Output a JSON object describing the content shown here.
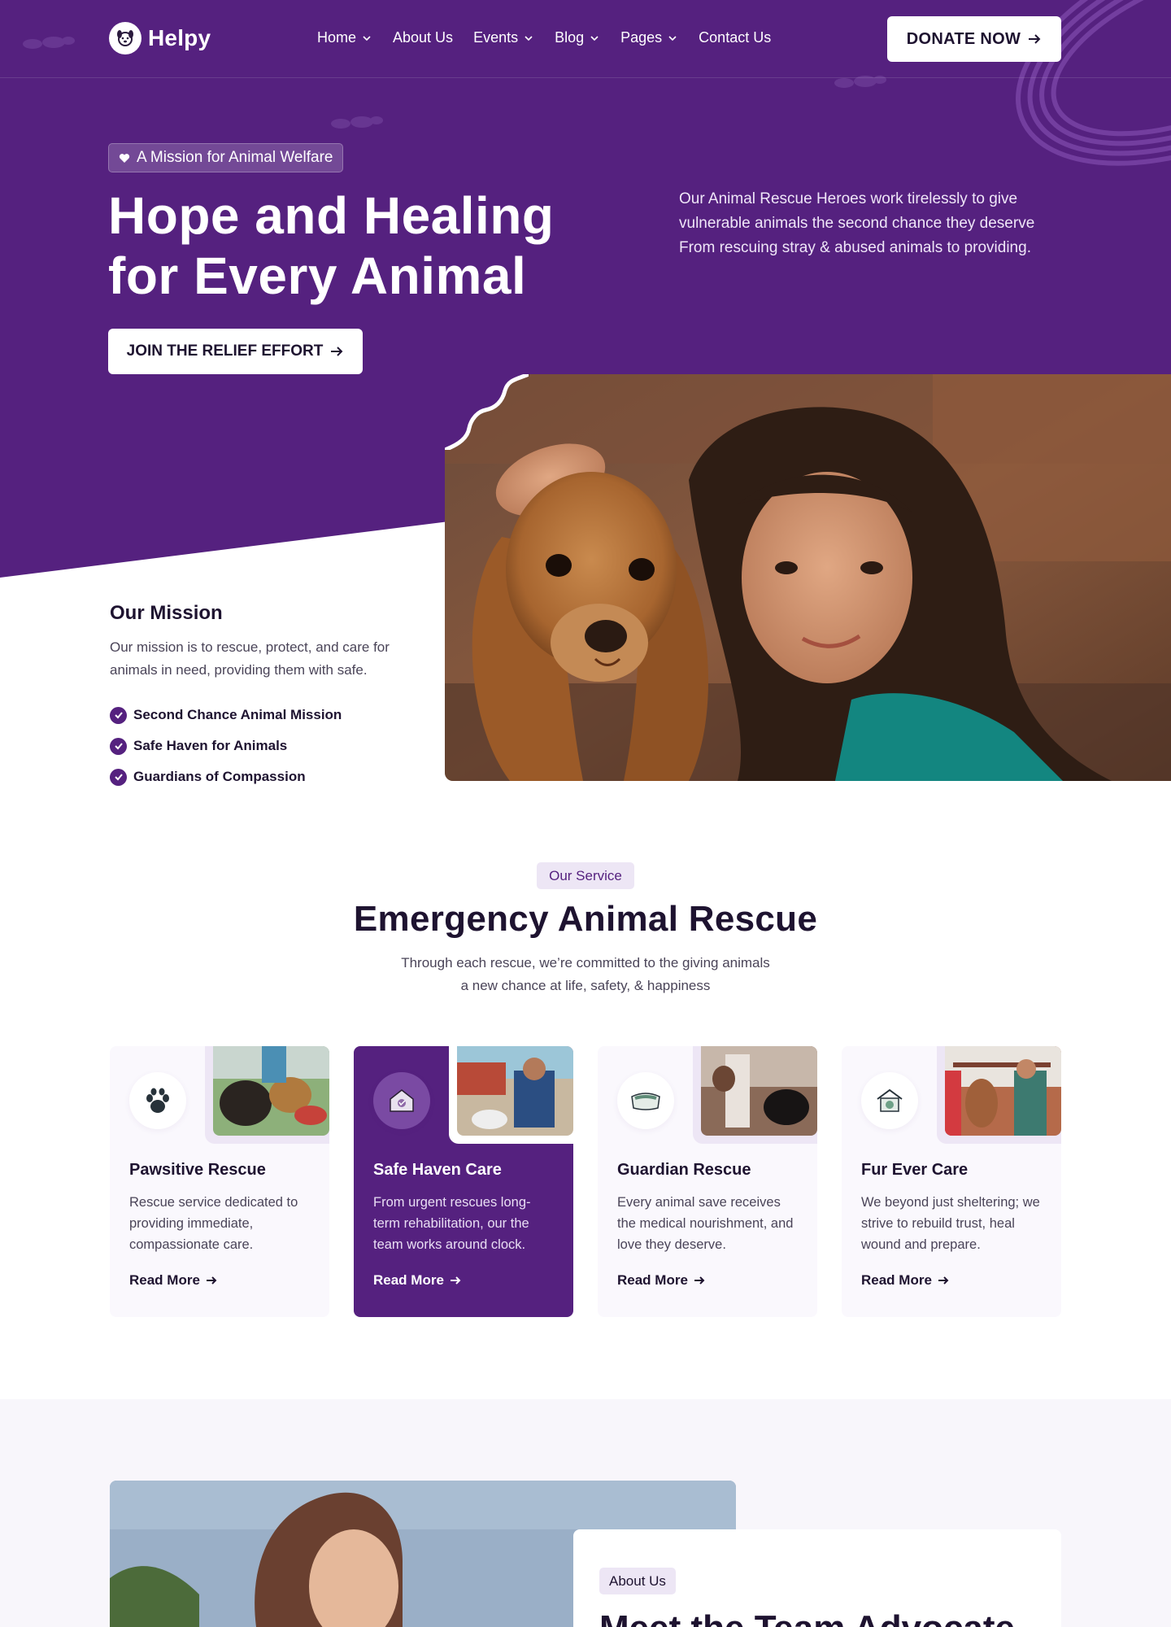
{
  "brand": {
    "name": "Helpy",
    "primary": "#55217f",
    "light": "#ede6f5"
  },
  "nav": {
    "items": [
      {
        "label": "Home",
        "has_dropdown": true
      },
      {
        "label": "About Us",
        "has_dropdown": false
      },
      {
        "label": "Events",
        "has_dropdown": true
      },
      {
        "label": "Blog",
        "has_dropdown": true
      },
      {
        "label": "Pages",
        "has_dropdown": true
      },
      {
        "label": "Contact Us",
        "has_dropdown": false
      }
    ],
    "donate_label": "DONATE NOW"
  },
  "hero": {
    "tag": "A Mission for Animal Welfare",
    "title_line1": "Hope and Healing",
    "title_line2": "for Every Animal",
    "description": "Our Animal Rescue Heroes work tirelessly to give vulnerable animals the second chance they deserve From rescuing stray & abused animals to providing.",
    "cta_label": "JOIN THE RELIEF EFFORT"
  },
  "mission": {
    "title": "Our Mission",
    "description": "Our mission is to rescue, protect, and care for animals in need, providing them with safe.",
    "points": [
      "Second Chance Animal Mission",
      "Safe Haven for Animals",
      "Guardians of Compassion"
    ]
  },
  "services": {
    "tag": "Our Service",
    "title": "Emergency Animal Rescue",
    "subtitle_line1": "Through each rescue, we’re committed to the giving animals",
    "subtitle_line2": "a new chance at life, safety, & happiness",
    "cards": [
      {
        "title": "Pawsitive Rescue",
        "description": "Rescue service dedicated to providing immediate, compassionate care.",
        "link": "Read More",
        "icon": "paw-icon"
      },
      {
        "title": "Safe Haven Care",
        "description": "From urgent rescues long-term rehabilitation, our the team works around clock.",
        "link": "Read More",
        "icon": "shelter-icon"
      },
      {
        "title": "Guardian Rescue",
        "description": "Every animal save receives the medical nourishment, and love they deserve.",
        "link": "Read More",
        "icon": "pet-bed-icon"
      },
      {
        "title": "Fur Ever Care",
        "description": "We beyond just sheltering; we strive to rebuild trust, heal wound and prepare.",
        "link": "Read More",
        "icon": "pet-house-icon"
      }
    ]
  },
  "about": {
    "tag": "About Us",
    "title": "Meet the Team Advocate"
  }
}
